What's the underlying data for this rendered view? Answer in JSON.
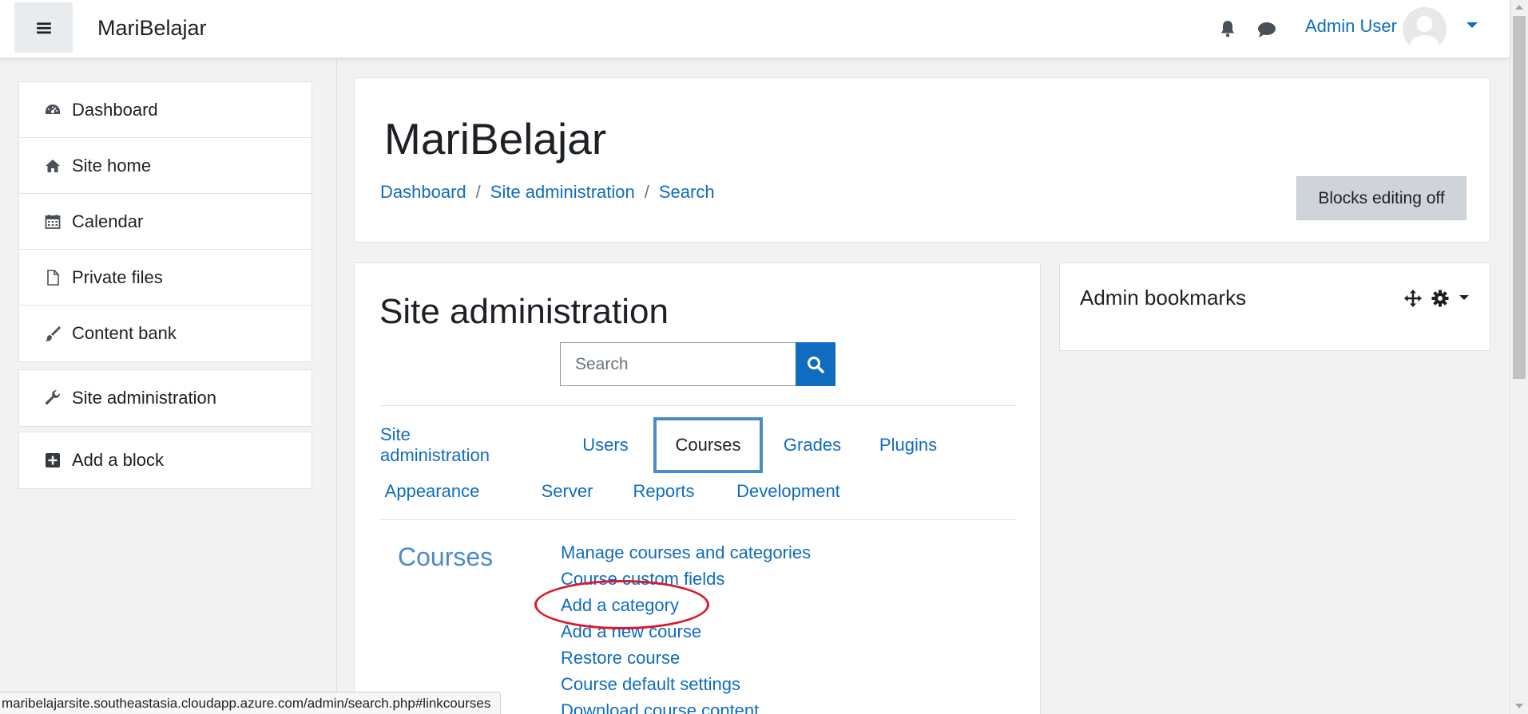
{
  "navbar": {
    "brand": "MariBelajar",
    "user_name": "Admin User",
    "icons": [
      "menu-icon",
      "bell-icon",
      "chat-icon",
      "avatar",
      "caret-down-icon"
    ]
  },
  "drawer": {
    "items": [
      {
        "label": "Dashboard",
        "icon": "dashboard-icon"
      },
      {
        "label": "Site home",
        "icon": "home-icon"
      },
      {
        "label": "Calendar",
        "icon": "calendar-icon"
      },
      {
        "label": "Private files",
        "icon": "file-icon"
      },
      {
        "label": "Content bank",
        "icon": "brush-icon"
      }
    ],
    "site_admin": {
      "label": "Site administration",
      "icon": "wrench-icon"
    },
    "add_block": {
      "label": "Add a block",
      "icon": "plus-square-icon"
    }
  },
  "header": {
    "title": "MariBelajar",
    "breadcrumb": [
      "Dashboard",
      "Site administration",
      "Search"
    ],
    "blocks_button": "Blocks editing off"
  },
  "main": {
    "title": "Site administration",
    "search": {
      "placeholder": "Search",
      "value": ""
    },
    "tabs": [
      "Site administration",
      "Users",
      "Courses",
      "Grades",
      "Plugins",
      "Appearance",
      "Server",
      "Reports",
      "Development"
    ],
    "active_tab": "Courses",
    "section_title": "Courses",
    "links": [
      "Manage courses and categories",
      "Course custom fields",
      "Add a category",
      "Add a new course",
      "Restore course",
      "Course default settings",
      "Download course content"
    ],
    "highlighted_link": "Add a category"
  },
  "block": {
    "title": "Admin bookmarks"
  },
  "status_url": "maribelajarsite.southeastasia.cloudapp.azure.com/admin/search.php#linkcourses",
  "colors": {
    "link": "#0f6cbf",
    "active_tab_border": "#4b8bc9",
    "highlight_ellipse": "#d9182d",
    "page_bg": "#f2f2f2"
  }
}
